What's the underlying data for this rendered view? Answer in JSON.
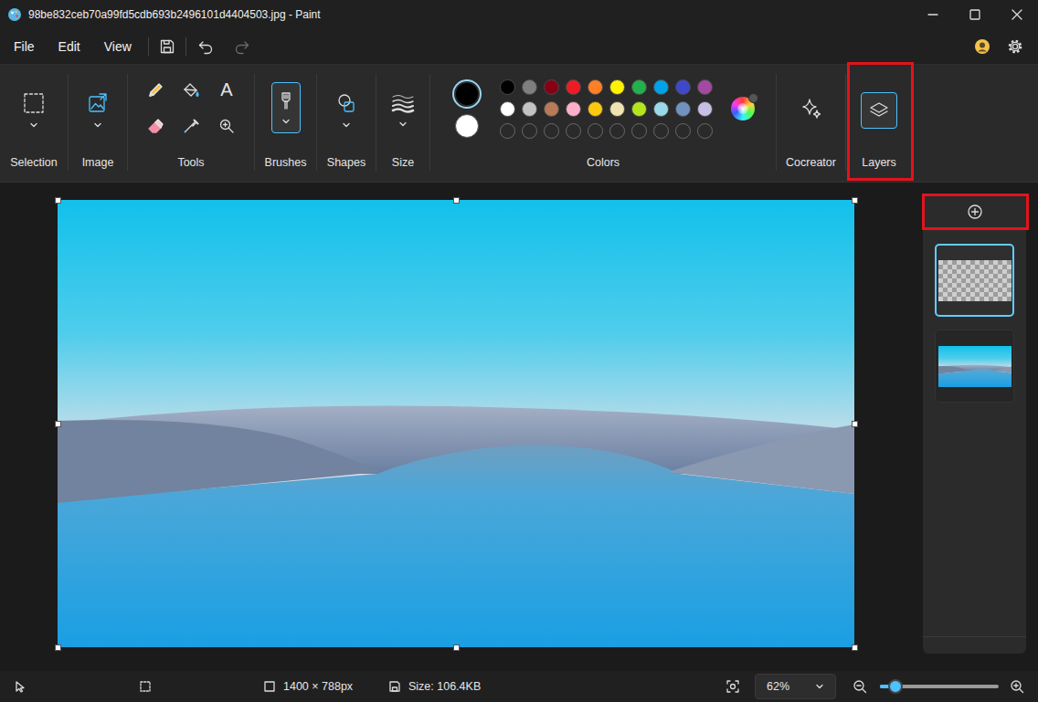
{
  "window": {
    "title": "98be832ceb70a99fd5cdb693b2496101d4404503.jpg - Paint"
  },
  "menu": [
    {
      "label": "File"
    },
    {
      "label": "Edit"
    },
    {
      "label": "View"
    }
  ],
  "history": [
    {
      "kind": "undo",
      "disabled": false
    },
    {
      "kind": "redo",
      "disabled": true
    }
  ],
  "toolbar": {
    "groups": [
      {
        "label": "Selection",
        "kind": "selection",
        "selected": false,
        "highlighted": false
      },
      {
        "label": "Image",
        "kind": "image",
        "selected": false,
        "highlighted": false
      },
      {
        "label": "Tools",
        "kind": "tools",
        "selected": false,
        "highlighted": false,
        "glyph": "A"
      },
      {
        "label": "Brushes",
        "kind": "brushes",
        "selected": true,
        "highlighted": false
      },
      {
        "label": "Shapes",
        "kind": "shapes",
        "selected": false,
        "highlighted": false
      },
      {
        "label": "Size",
        "kind": "size",
        "selected": false,
        "highlighted": false
      },
      {
        "label": "Colors",
        "kind": "colors",
        "selected": false,
        "highlighted": false
      },
      {
        "label": "Cocreator",
        "kind": "cocreator",
        "selected": false,
        "highlighted": false
      },
      {
        "label": "Layers",
        "kind": "layers",
        "selected": true,
        "highlighted": true
      }
    ]
  },
  "colors": {
    "primary": "#000000",
    "secondary": "#ffffff",
    "palette": [
      {
        "color": "#000000"
      },
      {
        "color": "#7f7f7f"
      },
      {
        "color": "#880015"
      },
      {
        "color": "#ed1c24"
      },
      {
        "color": "#ff7f27"
      },
      {
        "color": "#fff200"
      },
      {
        "color": "#22b14c"
      },
      {
        "color": "#00a2e8"
      },
      {
        "color": "#3f48cc"
      },
      {
        "color": "#a349a4"
      },
      {
        "color": "#ffffff"
      },
      {
        "color": "#c3c3c3"
      },
      {
        "color": "#b97a57"
      },
      {
        "color": "#ffaec9"
      },
      {
        "color": "#ffc90e"
      },
      {
        "color": "#efe4b0"
      },
      {
        "color": "#b5e61d"
      },
      {
        "color": "#99d9ea"
      },
      {
        "color": "#7092be"
      },
      {
        "color": "#c8bfe7"
      }
    ],
    "custom": [
      {
        "filled": false
      },
      {
        "filled": false
      },
      {
        "filled": false
      },
      {
        "filled": false
      },
      {
        "filled": false
      },
      {
        "filled": false
      },
      {
        "filled": false
      },
      {
        "filled": false
      },
      {
        "filled": false
      },
      {
        "filled": false
      }
    ]
  },
  "canvas": {
    "resize_handles": true
  },
  "layers_panel": {
    "add_highlighted": true,
    "layers": [
      {
        "kind": "transparent",
        "selected": true
      },
      {
        "kind": "image",
        "selected": false
      }
    ]
  },
  "status_bar": {
    "dimensions": "1400 × 788px",
    "size": "Size: 106.4KB",
    "zoom": "62%",
    "zoom_level": 0.13
  }
}
